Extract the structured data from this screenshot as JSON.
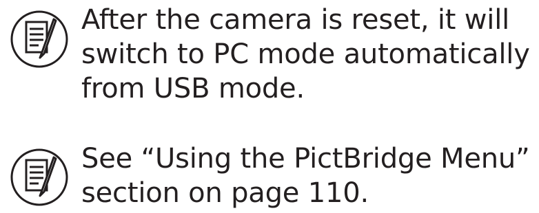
{
  "notes": [
    {
      "icon": "memo-note-icon",
      "lines": [
        "After the camera is reset, it will",
        "switch to PC mode automatically",
        "from USB mode."
      ]
    },
    {
      "icon": "memo-note-icon",
      "lines": [
        "See “Using the PictBridge Menu”",
        "section on page 110."
      ]
    }
  ],
  "colors": {
    "text": "#231f20",
    "icon_stroke": "#231f20",
    "background": "#ffffff"
  }
}
